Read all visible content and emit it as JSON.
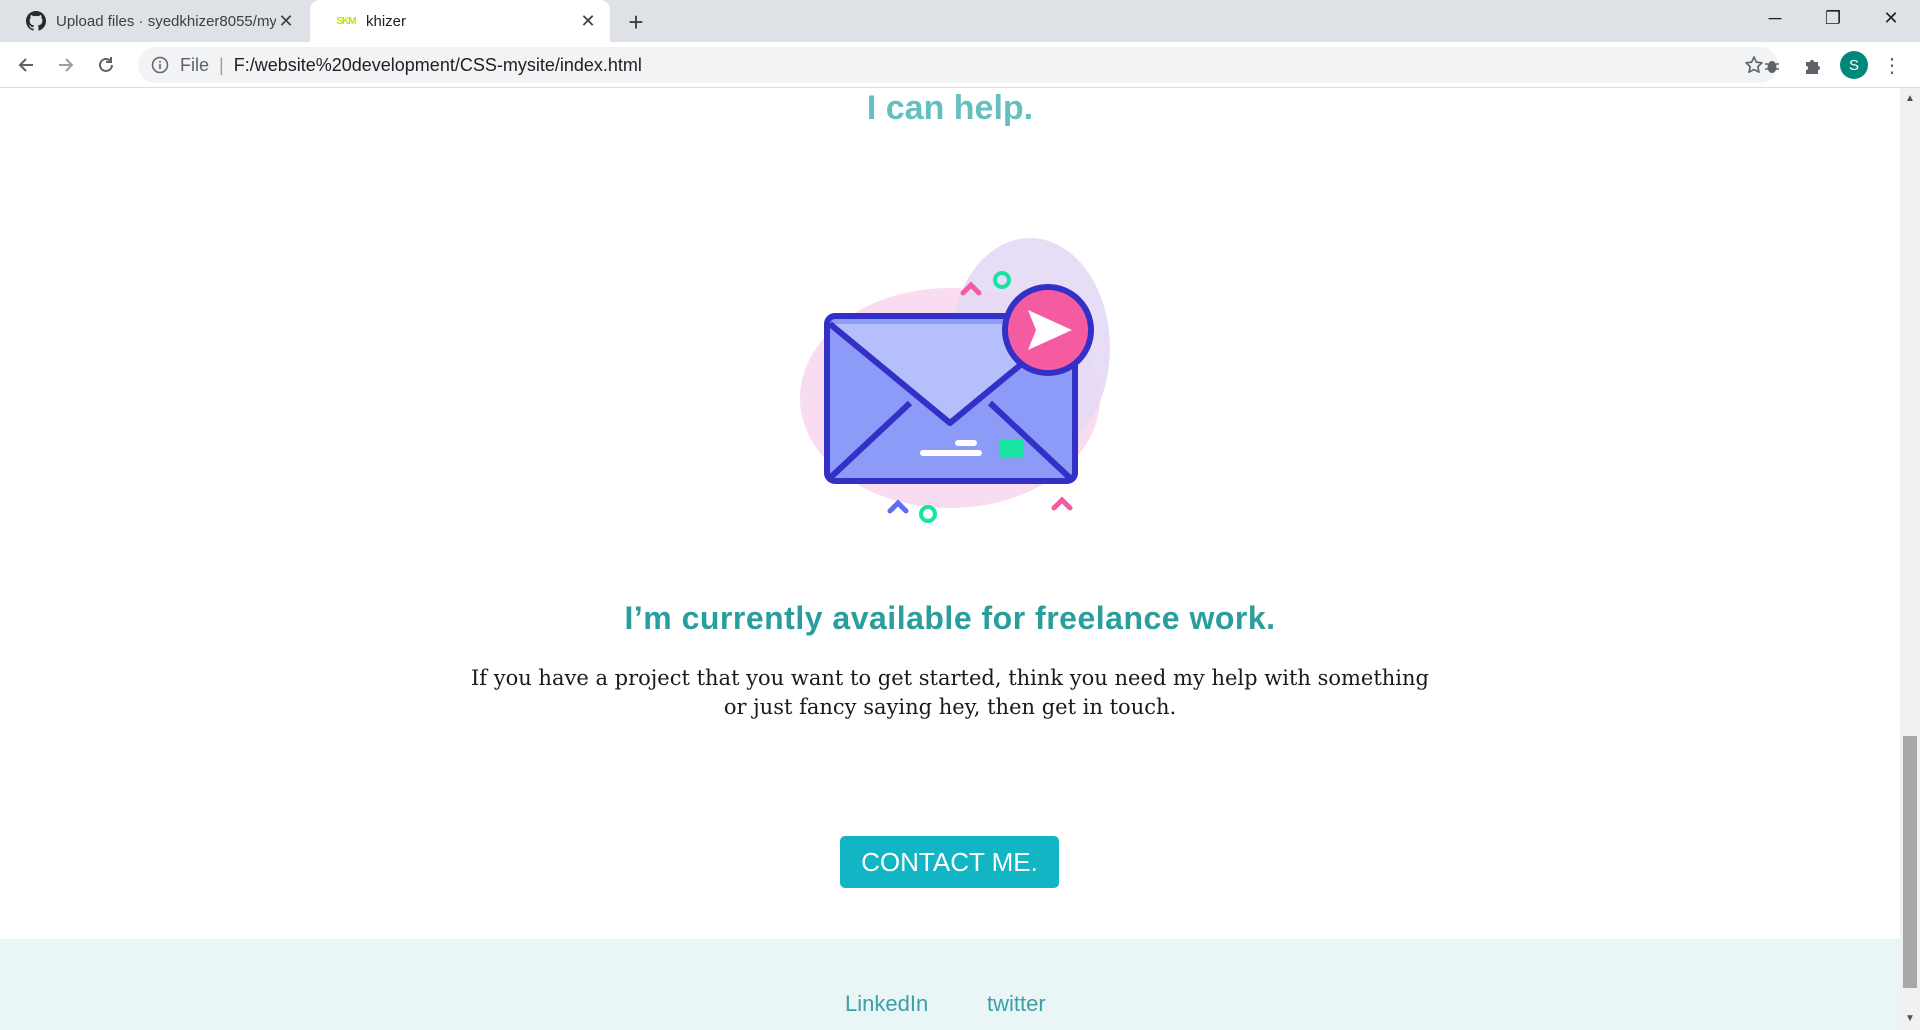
{
  "browser": {
    "tabs": [
      {
        "title": "Upload files · syedkhizer8055/my",
        "favicon": "github-icon",
        "active": false
      },
      {
        "title": "khizer",
        "favicon": "site-icon",
        "favicon_text": "SKM",
        "active": true
      }
    ],
    "new_tab_label": "+",
    "omnibox": {
      "scheme": "File",
      "url": "F:/website%20development/CSS-mysite/index.html"
    },
    "profile_initial": "S"
  },
  "page": {
    "heading_help": "I can help.",
    "heading_freelance": "I’m currently available for freelance work.",
    "paragraph": "If you have a project that you want to get started, think you need my help with something or just fancy saying hey, then get in touch.",
    "contact_button": "CONTACT ME.",
    "footer_links": [
      "LinkedIn",
      "twitter"
    ]
  },
  "colors": {
    "accent_teal": "#66bfbf",
    "heading_teal": "#2a9d9d",
    "button_teal": "#11b5c3",
    "footer_bg": "#eaf6f6"
  }
}
